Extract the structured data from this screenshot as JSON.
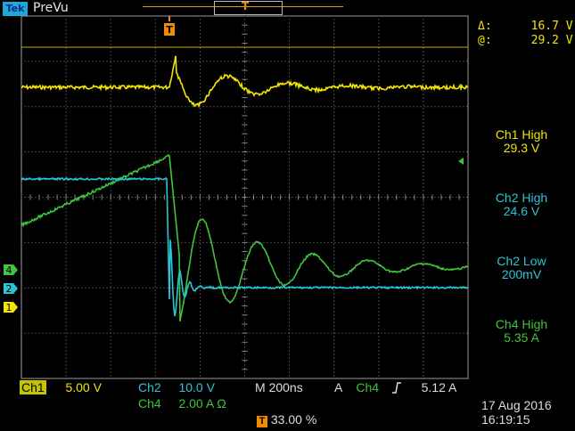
{
  "header": {
    "logo": "Tek",
    "acq_state": "PreVu"
  },
  "readout": {
    "delta_label": "Δ:",
    "delta_value": "16.7 V",
    "at_label": "@:",
    "at_value": "29.2 V"
  },
  "measurements": [
    {
      "label": "Ch1 High",
      "value": "29.3 V",
      "color": "#f2e600"
    },
    {
      "label": "Ch2 High",
      "value": "24.6 V",
      "color": "#2cc5d8"
    },
    {
      "label": "Ch2 Low",
      "value": "200mV",
      "color": "#2cc5d8"
    },
    {
      "label": "Ch4 High",
      "value": "5.35 A",
      "color": "#3ec43e"
    }
  ],
  "channel_markers": {
    "ch4": "4",
    "ch2": "2",
    "ch1": "1"
  },
  "scales": {
    "ch1_label": "Ch1",
    "ch1_value": "5.00 V",
    "ch2_label": "Ch2",
    "ch2_value": "10.0 V",
    "ch4_label": "Ch4",
    "ch4_value": "2.00 A Ω",
    "timebase_label": "M",
    "timebase_value": "200ns",
    "trigger_mode": "A",
    "trigger_channel": "Ch4",
    "trigger_slope_icon": "rising-edge-icon",
    "trigger_level": "5.12 A",
    "trigger_position_icon": "trigger-t-icon",
    "trigger_position": "33.00 %"
  },
  "datetime": {
    "date": "17 Aug 2016",
    "time": "16:19:15"
  },
  "colors": {
    "ch1": "#f2e600",
    "ch2": "#2cc5d8",
    "ch4": "#3ec43e",
    "trigger": "#f08c00",
    "grid": "#8a8a8a"
  }
}
